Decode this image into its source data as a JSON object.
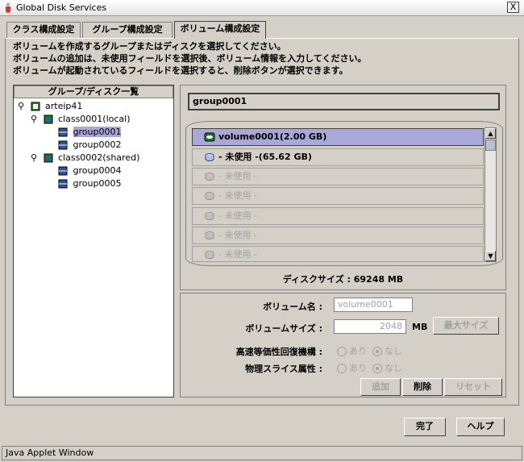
{
  "window": {
    "title": "Global Disk Services",
    "close": "X"
  },
  "tabs": [
    {
      "label": "クラス構成設定"
    },
    {
      "label": "グループ構成設定"
    },
    {
      "label": "ボリューム構成設定",
      "active": true
    }
  ],
  "instructions": [
    "ボリュームを作成するグループまたはディスクを選択してください。",
    "ボリュームの追加は、未使用フィールドを選択後、ボリューム情報を入力してください。",
    "ボリュームが起動されているフィールドを選択すると、削除ボタンが選択できます。"
  ],
  "tree": {
    "header": "グループ/ディスク一覧",
    "nodes": [
      {
        "label": "arteip41",
        "icon": "host-icon"
      },
      {
        "label": "class0001(local)",
        "icon": "class-icon"
      },
      {
        "label": "group0001",
        "icon": "group-icon",
        "selected": true
      },
      {
        "label": "group0002",
        "icon": "group-icon"
      },
      {
        "label": "class0002(shared)",
        "icon": "class-icon"
      },
      {
        "label": "group0004",
        "icon": "group-icon"
      },
      {
        "label": "group0005",
        "icon": "group-icon"
      }
    ]
  },
  "group_label": "group0001",
  "volumes": [
    {
      "label": "volume0001(2.00 GB)",
      "state": "selected"
    },
    {
      "label": "- 未使用 -(65.62 GB)",
      "state": "used"
    },
    {
      "label": "- 未使用 -",
      "state": "disabled"
    },
    {
      "label": "- 未使用 -",
      "state": "disabled"
    },
    {
      "label": "- 未使用 -",
      "state": "disabled"
    },
    {
      "label": "- 未使用 -",
      "state": "disabled"
    },
    {
      "label": "- 未使用 -",
      "state": "disabled"
    }
  ],
  "disk_size": "ディスクサイズ : 69248 MB",
  "form": {
    "volume_name_label": "ボリューム名 :",
    "volume_name_value": "volume0001",
    "volume_size_label": "ボリュームサイズ :",
    "volume_size_value": "2048",
    "unit": "MB",
    "max_size_button": "最大サイズ",
    "fast_recovery_label": "高速等価性回復機構 :",
    "physical_slice_label": "物理スライス属性 :",
    "on": "あり",
    "off": "なし",
    "add_button": "追加",
    "delete_button": "削除",
    "reset_button": "リセット"
  },
  "ok_button": "完了",
  "help_button": "ヘルプ",
  "status": "Java Applet Window"
}
